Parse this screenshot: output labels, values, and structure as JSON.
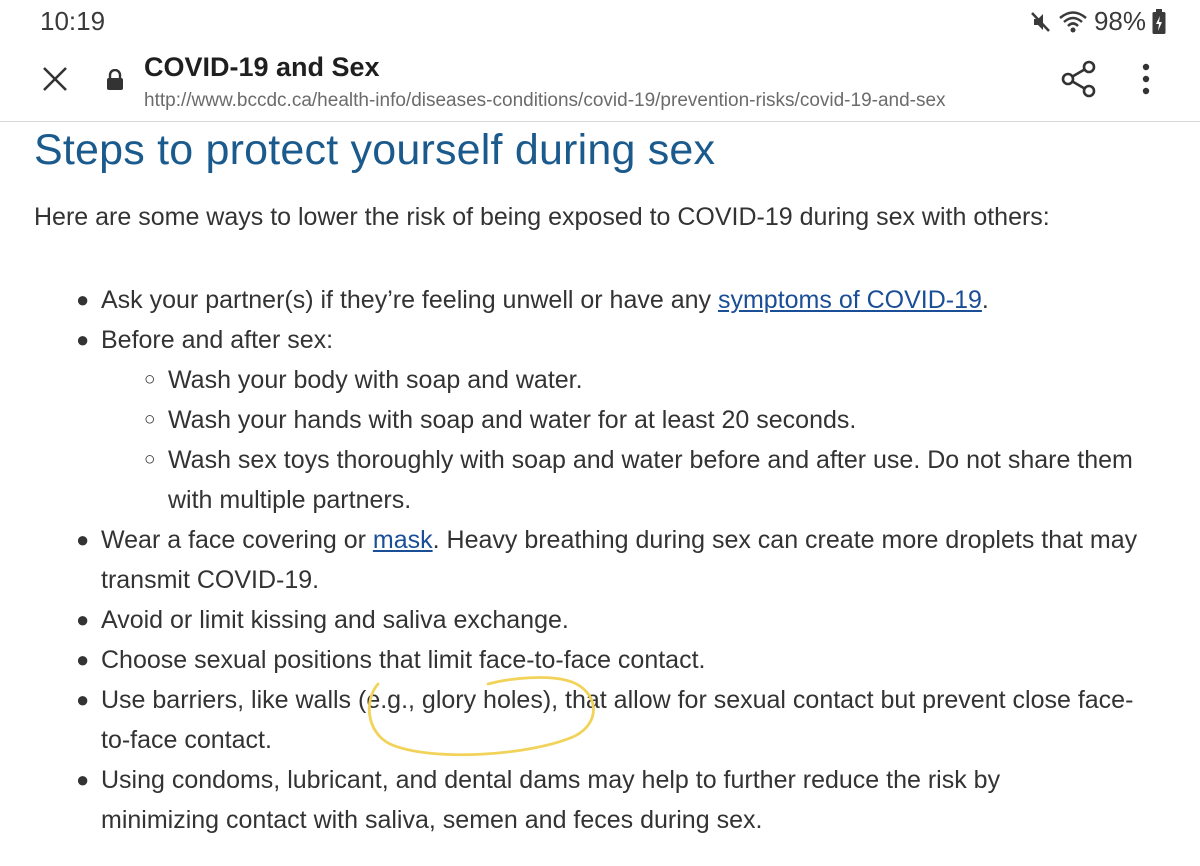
{
  "status_bar": {
    "time": "10:19",
    "battery": "98%",
    "icons": [
      "mute-icon",
      "wifi-icon",
      "battery-charging-icon"
    ]
  },
  "toolbar": {
    "title": "COVID-19 and Sex",
    "url": "http://www.bccdc.ca/health-info/diseases-conditions/covid-19/prevention-risks/covid-19-and-sex",
    "icons": [
      "close-icon",
      "lock-icon",
      "share-icon",
      "more-vert-icon"
    ]
  },
  "content": {
    "heading": "Steps to protect yourself during sex",
    "intro": "Here are some ways to lower the risk of being exposed to COVID-19 during sex with others:",
    "items": {
      "ask": {
        "before": "Ask your partner(s) if they’re feeling unwell or have any ",
        "link": "symptoms of COVID-19",
        "after": "."
      },
      "before_after": "Before and after sex:",
      "sub": [
        "Wash your body with soap and water.",
        "Wash your hands with soap and water for at least 20 seconds.",
        "Wash sex toys thoroughly with soap and water before and after use. Do not share them with multiple partners."
      ],
      "mask": {
        "before": "Wear a face covering or ",
        "link": "mask",
        "after": ". Heavy breathing during sex can create more droplets that may transmit COVID-19."
      },
      "kissing": "Avoid or limit kissing and saliva exchange.",
      "positions": "Choose sexual positions that limit face-to-face contact.",
      "barriers": "Use barriers, like walls (e.g., glory holes), that allow for sexual contact but prevent close face-to-face contact.",
      "condoms": "Using condoms, lubricant, and dental dams may help to further reduce the risk by minimizing contact with saliva, semen and feces during sex."
    }
  },
  "annotation": {
    "color": "#f2d35a"
  },
  "colors": {
    "heading": "#1b5a8c",
    "link": "#1a4e96",
    "text": "#333333"
  }
}
